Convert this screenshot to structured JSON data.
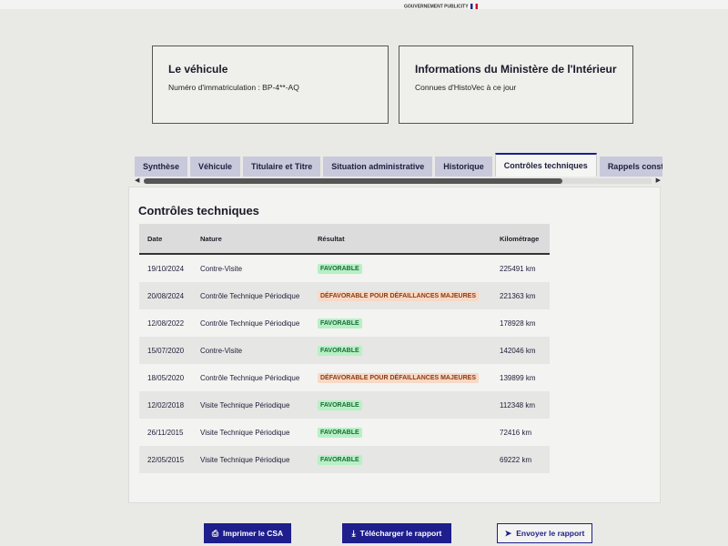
{
  "header": {
    "logo_text": "GOUVERNEMENT PUBLICITY"
  },
  "cards": {
    "vehicule": {
      "title": "Le véhicule",
      "text": "Numéro d'immatriculation : BP-4**-AQ"
    },
    "ministere": {
      "title": "Informations du Ministère de l'Intérieur",
      "text": "Connues d'HistoVec à ce jour"
    }
  },
  "tabs": [
    {
      "label": "Synthèse"
    },
    {
      "label": "Véhicule"
    },
    {
      "label": "Titulaire et Titre"
    },
    {
      "label": "Situation administrative"
    },
    {
      "label": "Historique"
    },
    {
      "label": "Contrôles techniques",
      "active": true
    },
    {
      "label": "Rappels constructeur"
    }
  ],
  "panel": {
    "title": "Contrôles techniques",
    "columns": {
      "date": "Date",
      "nature": "Nature",
      "resultat": "Résultat",
      "km": "Kilométrage"
    },
    "rows": [
      {
        "date": "19/10/2024",
        "nature": "Contre-Visite",
        "resultat": "FAVORABLE",
        "km": "225491 km"
      },
      {
        "date": "20/08/2024",
        "nature": "Contrôle Technique Périodique",
        "resultat": "DÉFAVORABLE POUR DÉFAILLANCES MAJEURES",
        "km": "221363 km"
      },
      {
        "date": "12/08/2022",
        "nature": "Contrôle Technique Périodique",
        "resultat": "FAVORABLE",
        "km": "178928 km"
      },
      {
        "date": "15/07/2020",
        "nature": "Contre-Visite",
        "resultat": "FAVORABLE",
        "km": "142046 km"
      },
      {
        "date": "18/05/2020",
        "nature": "Contrôle Technique Périodique",
        "resultat": "DÉFAVORABLE POUR DÉFAILLANCES MAJEURES",
        "km": "139899 km"
      },
      {
        "date": "12/02/2018",
        "nature": "Visite Technique Périodique",
        "resultat": "FAVORABLE",
        "km": "112348 km"
      },
      {
        "date": "26/11/2015",
        "nature": "Visite Technique Périodique",
        "resultat": "FAVORABLE",
        "km": "72416 km"
      },
      {
        "date": "22/05/2015",
        "nature": "Visite Technique Périodique",
        "resultat": "FAVORABLE",
        "km": "69222 km"
      }
    ]
  },
  "buttons": {
    "print": "Imprimer le CSA",
    "download": "Télécharger le rapport",
    "send": "Envoyer le rapport"
  },
  "colors": {
    "primary": "#1e1e8c",
    "favorable_bg": "#b8f0c6",
    "defavorable_bg": "#f7d9c6"
  }
}
